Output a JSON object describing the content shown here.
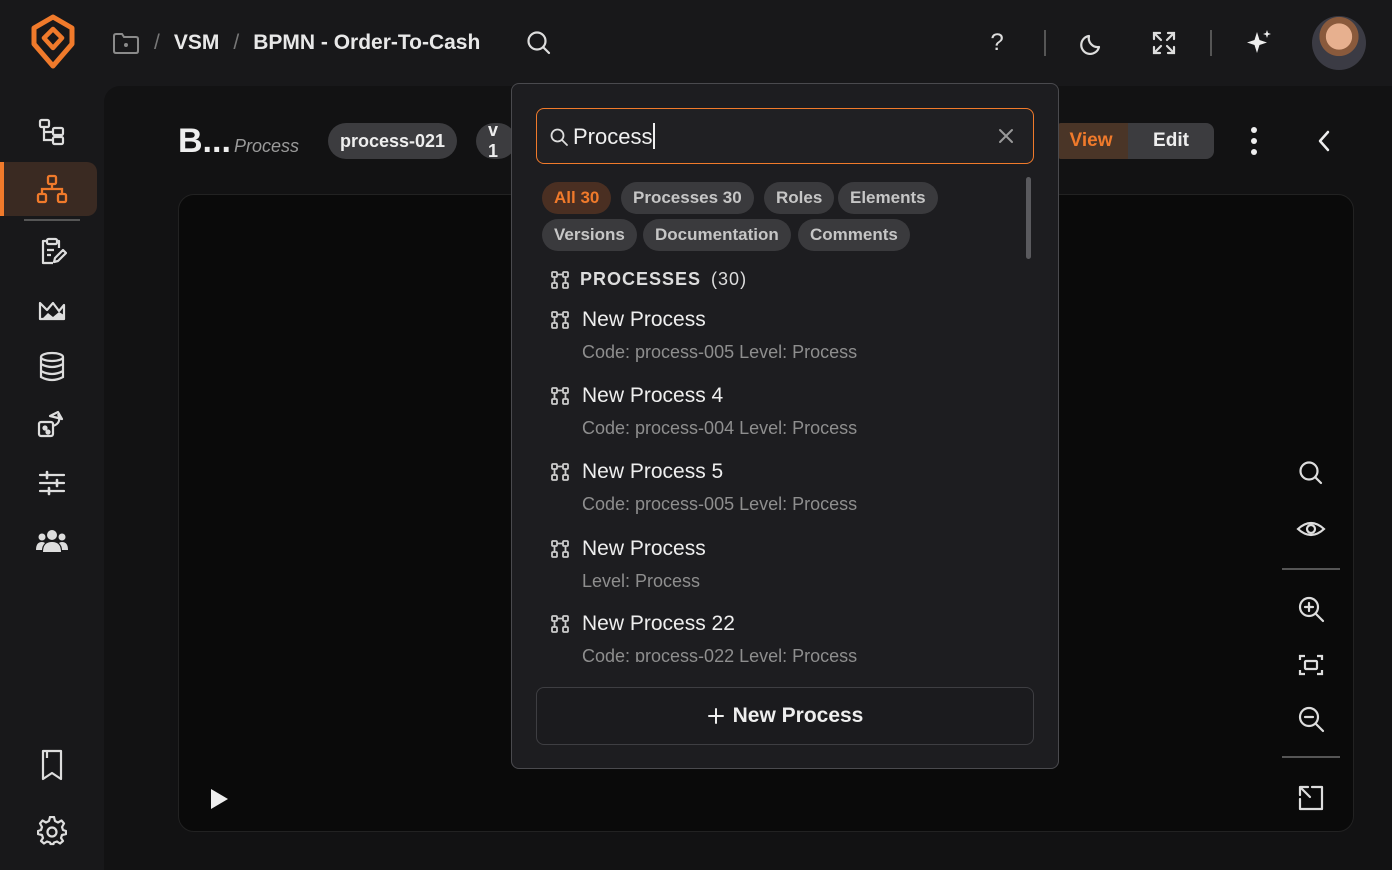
{
  "breadcrumb": {
    "items": [
      "VSM",
      "BPMN - Order-To-Cash"
    ],
    "separator": "/"
  },
  "header": {
    "help_label": "?"
  },
  "process_header": {
    "title_truncated": "B...",
    "level": "Process",
    "code_chip": "process-021",
    "version_chip": "v 1",
    "mode_toggle": {
      "view": "View",
      "edit": "Edit",
      "selected": "View"
    }
  },
  "search": {
    "value": "Process",
    "filters": [
      {
        "label": "All 30",
        "active": true
      },
      {
        "label": "Processes 30",
        "active": false
      },
      {
        "label": "Roles",
        "active": false
      },
      {
        "label": "Elements",
        "active": false
      },
      {
        "label": "Versions",
        "active": false
      },
      {
        "label": "Documentation",
        "active": false
      },
      {
        "label": "Comments",
        "active": false
      }
    ],
    "section": {
      "title": "PROCESSES",
      "count": "(30)"
    },
    "results": [
      {
        "name": "New Process",
        "meta": "Code: process-005 Level: Process"
      },
      {
        "name": "New Process 4",
        "meta": "Code: process-004 Level: Process"
      },
      {
        "name": "New Process 5",
        "meta": "Code: process-005 Level: Process"
      },
      {
        "name": "New Process",
        "meta": "Level: Process"
      },
      {
        "name": "New Process 22",
        "meta": "Code: process-022 Level: Process"
      }
    ],
    "new_button": "New Process"
  },
  "sidebar": {
    "items": [
      "tree-structure-icon",
      "process-hierarchy-icon",
      "clipboard-edit-icon",
      "mountain-chart-icon",
      "database-icon",
      "shapes-icon",
      "sliders-icon",
      "users-icon"
    ],
    "bottom": [
      "bookmark-icon",
      "gear-icon"
    ],
    "active": "process-hierarchy-icon"
  },
  "colors": {
    "accent": "#f07a2b",
    "background": "#18181a",
    "canvas": "#0a0a0a"
  }
}
